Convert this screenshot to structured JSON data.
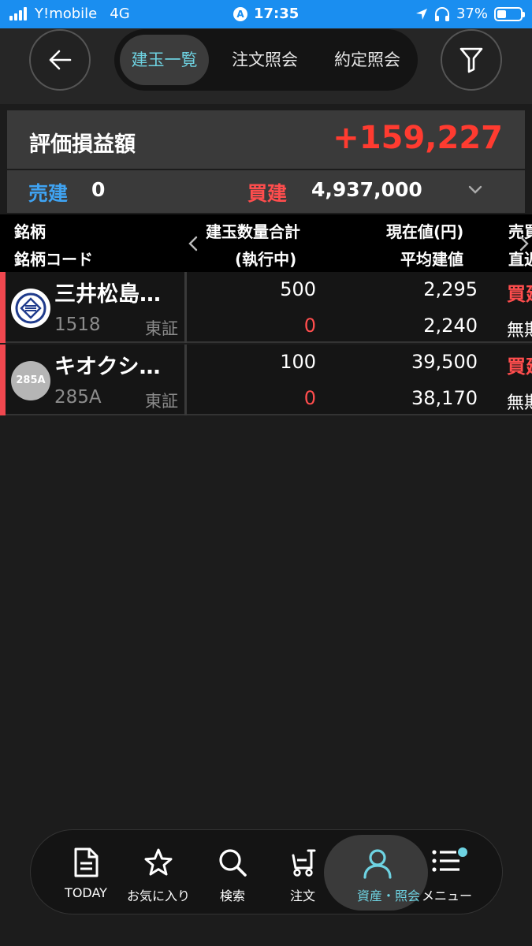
{
  "status_bar": {
    "carrier": "Y!mobile",
    "network": "4G",
    "time": "17:35",
    "battery": "37%",
    "battery_level": 0.37,
    "location_badge": "A"
  },
  "header": {
    "tabs": [
      {
        "label": "建玉一覧",
        "active": true
      },
      {
        "label": "注文照会",
        "active": false
      },
      {
        "label": "約定照会",
        "active": false
      }
    ],
    "icons": {
      "back": "back-arrow-icon",
      "filter": "filter-icon"
    }
  },
  "summary": {
    "pnl_label": "評価損益額",
    "pnl_value": "+159,227",
    "sell_label": "売建",
    "sell_value": "0",
    "buy_label": "買建",
    "buy_value": "4,937,000"
  },
  "table": {
    "columns": {
      "name_line1": "銘柄",
      "name_line2": "銘柄コード",
      "qty_line1": "建玉数量合計",
      "qty_line2": "(執行中)",
      "price_line1": "現在値(円)",
      "price_line2": "平均建値",
      "side_line1": "売買",
      "side_line2": "直近"
    },
    "rows": [
      {
        "name": "三井松島…",
        "code": "1518",
        "exchange": "東証",
        "qty": "500",
        "executing": "0",
        "price": "2,295",
        "avg_price": "2,240",
        "side": "買建",
        "side2": "無期限",
        "logo": "mitsui-matsushima-logo"
      },
      {
        "name": "キオクシ…",
        "code": "285A",
        "exchange": "東証",
        "qty": "100",
        "executing": "0",
        "price": "39,500",
        "avg_price": "38,170",
        "side": "買建",
        "side2": "無期限",
        "logo_text": "285A"
      }
    ]
  },
  "bottom_nav": {
    "items": [
      {
        "label": "TODAY",
        "icon": "document-icon",
        "active": false
      },
      {
        "label": "お気に入り",
        "icon": "star-icon",
        "active": false
      },
      {
        "label": "検索",
        "icon": "search-icon",
        "active": false
      },
      {
        "label": "注文",
        "icon": "cart-icon",
        "active": false
      },
      {
        "label": "資産・照会",
        "icon": "person-icon",
        "active": true
      },
      {
        "label": "メニュー",
        "icon": "menu-icon",
        "active": false
      }
    ]
  },
  "colors": {
    "status_bar": "#1a8ef0",
    "accent_cyan": "#6ed3e2",
    "profit_red": "#ff3b30",
    "sell_blue": "#3fa3f2",
    "buy_red": "#ff4d4d"
  }
}
